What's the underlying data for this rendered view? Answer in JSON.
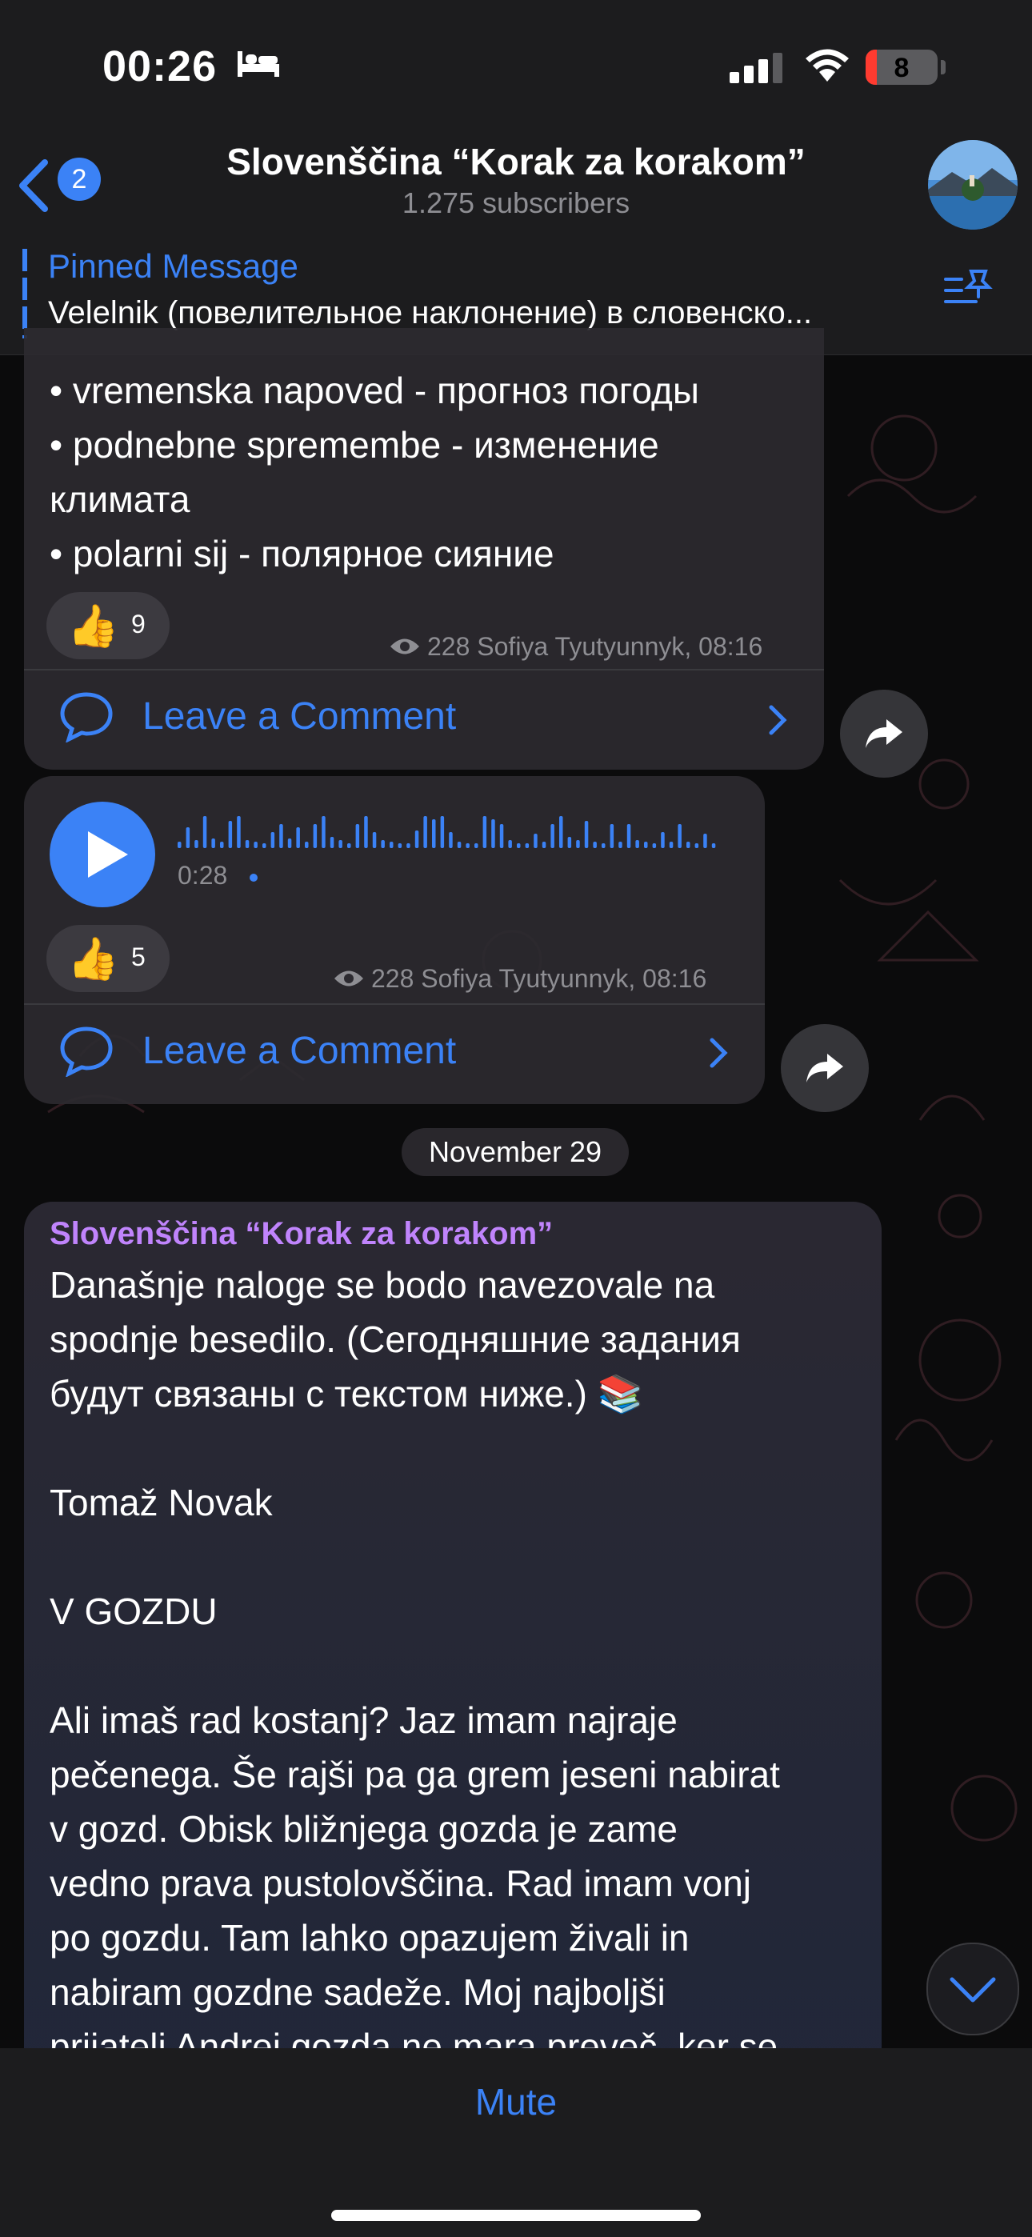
{
  "status_bar": {
    "time": "00:26",
    "battery": "8"
  },
  "header": {
    "back_count": "2",
    "title": "Slovenščina “Korak za korakom”",
    "subtitle": "1.275 subscribers"
  },
  "pinned": {
    "title": "Pinned Message",
    "text": "Velelnik (повелительное наклонение) в словенско..."
  },
  "messages": [
    {
      "lines": [
        "• vremenska napoved - прогноз погоды",
        "• podnebne spremembe - изменение",
        "климата",
        "• polarni sij - полярное сияние"
      ],
      "reaction_emoji": "👍",
      "reaction_count": "9",
      "meta": "228 Sofiya Tyutyunnyk, 08:16",
      "comment_label": "Leave a Comment"
    },
    {
      "voice_duration": "0:28",
      "reaction_emoji": "👍",
      "reaction_count": "5",
      "meta": "228 Sofiya Tyutyunnyk, 08:16",
      "comment_label": "Leave a Comment"
    }
  ],
  "date_divider": "November 29",
  "post": {
    "author": "Slovenščina “Korak za korakom”",
    "lines": [
      "Današnje naloge se bodo navezovale na",
      "spodnje besedilo. (Сегодняшние задания",
      "будут связаны с текстом ниже.) 📚",
      "",
      "Tomaž Novak",
      "",
      "V GOZDU",
      "",
      "Ali imaš rad kostanj? Jaz imam najraje",
      "pečenega. Še rajši pa ga grem jeseni nabirat",
      "v gozd. Obisk bližnjega gozda je zame",
      "vedno prava pustolovščina. Rad imam vonj",
      "po gozdu. Tam lahko opazujem živali in",
      "nabiram gozdne sadeže. Moj najboljši",
      "prijatelj Andrej gozda ne mara preveč, ker se"
    ]
  },
  "bottom_bar": {
    "mute_label": "Mute"
  }
}
